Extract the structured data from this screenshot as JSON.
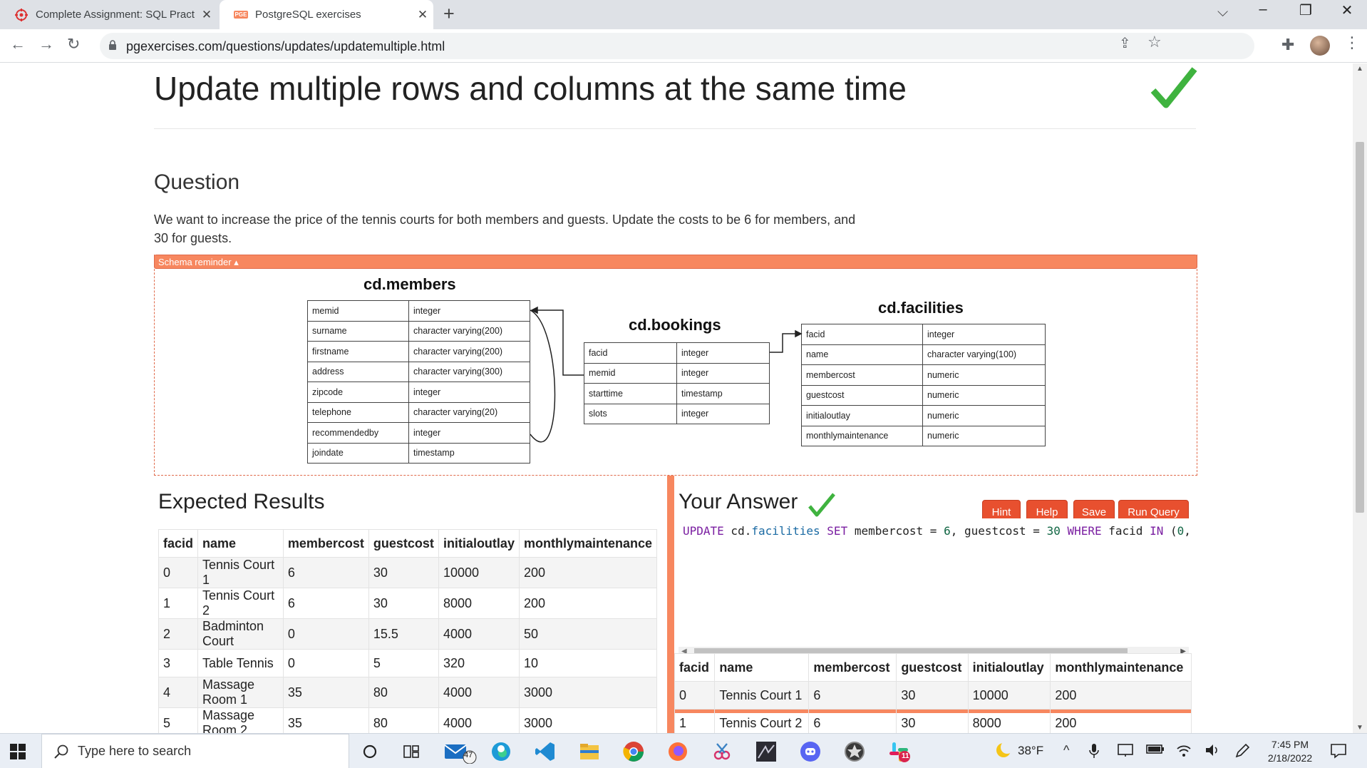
{
  "browser": {
    "tabs": [
      {
        "title": "Complete Assignment: SQL Pract",
        "close": "✕"
      },
      {
        "title": "PostgreSQL exercises",
        "favicon_text": "PGE",
        "close": "✕"
      }
    ],
    "new_tab": "+",
    "url": "pgexercises.com/questions/updates/updatemultiple.html"
  },
  "page": {
    "title": "Update multiple rows and columns at the same time",
    "question_heading": "Question",
    "question_text": "We want to increase the price of the tennis courts for both members and guests. Update the costs to be 6 for members, and 30 for guests.",
    "schema_reminder": "Schema reminder ▴"
  },
  "schema": {
    "members": {
      "title": "cd.members",
      "columns": [
        [
          "memid",
          "integer"
        ],
        [
          "surname",
          "character varying(200)"
        ],
        [
          "firstname",
          "character varying(200)"
        ],
        [
          "address",
          "character varying(300)"
        ],
        [
          "zipcode",
          "integer"
        ],
        [
          "telephone",
          "character varying(20)"
        ],
        [
          "recommendedby",
          "integer"
        ],
        [
          "joindate",
          "timestamp"
        ]
      ]
    },
    "bookings": {
      "title": "cd.bookings",
      "columns": [
        [
          "facid",
          "integer"
        ],
        [
          "memid",
          "integer"
        ],
        [
          "starttime",
          "timestamp"
        ],
        [
          "slots",
          "integer"
        ]
      ]
    },
    "facilities": {
      "title": "cd.facilities",
      "columns": [
        [
          "facid",
          "integer"
        ],
        [
          "name",
          "character varying(100)"
        ],
        [
          "membercost",
          "numeric"
        ],
        [
          "guestcost",
          "numeric"
        ],
        [
          "initialoutlay",
          "numeric"
        ],
        [
          "monthlymaintenance",
          "numeric"
        ]
      ]
    }
  },
  "expected": {
    "heading": "Expected Results",
    "headers": [
      "facid",
      "name",
      "membercost",
      "guestcost",
      "initialoutlay",
      "monthlymaintenance"
    ],
    "rows": [
      [
        "0",
        "Tennis Court 1",
        "6",
        "30",
        "10000",
        "200"
      ],
      [
        "1",
        "Tennis Court 2",
        "6",
        "30",
        "8000",
        "200"
      ],
      [
        "2",
        "Badminton Court",
        "0",
        "15.5",
        "4000",
        "50"
      ],
      [
        "3",
        "Table Tennis",
        "0",
        "5",
        "320",
        "10"
      ],
      [
        "4",
        "Massage Room 1",
        "35",
        "80",
        "4000",
        "3000"
      ],
      [
        "5",
        "Massage Room 2",
        "35",
        "80",
        "4000",
        "3000"
      ]
    ]
  },
  "answer": {
    "heading": "Your Answer",
    "buttons": {
      "hint": "Hint",
      "help": "Help",
      "save": "Save",
      "run": "Run Query"
    },
    "sql_tokens": [
      {
        "t": "UPDATE",
        "c": "kw"
      },
      {
        "t": " cd.",
        "c": ""
      },
      {
        "t": "facilities",
        "c": "prop"
      },
      {
        "t": " ",
        "c": ""
      },
      {
        "t": "SET",
        "c": "kw"
      },
      {
        "t": " membercost = ",
        "c": ""
      },
      {
        "t": "6",
        "c": "num"
      },
      {
        "t": ", guestcost = ",
        "c": ""
      },
      {
        "t": "30",
        "c": "num"
      },
      {
        "t": " ",
        "c": ""
      },
      {
        "t": "WHERE",
        "c": "kw"
      },
      {
        "t": " facid ",
        "c": ""
      },
      {
        "t": "IN",
        "c": "kw"
      },
      {
        "t": " (",
        "c": ""
      },
      {
        "t": "0",
        "c": "num"
      },
      {
        "t": ",",
        "c": ""
      }
    ],
    "result_headers": [
      "facid",
      "name",
      "membercost",
      "guestcost",
      "initialoutlay",
      "monthlymaintenance"
    ],
    "result_rows": [
      [
        "0",
        "Tennis Court 1",
        "6",
        "30",
        "10000",
        "200"
      ],
      [
        "1",
        "Tennis Court 2",
        "6",
        "30",
        "8000",
        "200"
      ]
    ]
  },
  "taskbar": {
    "search_placeholder": "Type here to search",
    "mail_badge": "47",
    "slack_badge": "11",
    "weather": "38°F",
    "time": "7:45 PM",
    "date": "2/18/2022"
  },
  "colors": {
    "accent": "#f7875f",
    "button": "#e8502f",
    "check": "#3fb33f"
  }
}
